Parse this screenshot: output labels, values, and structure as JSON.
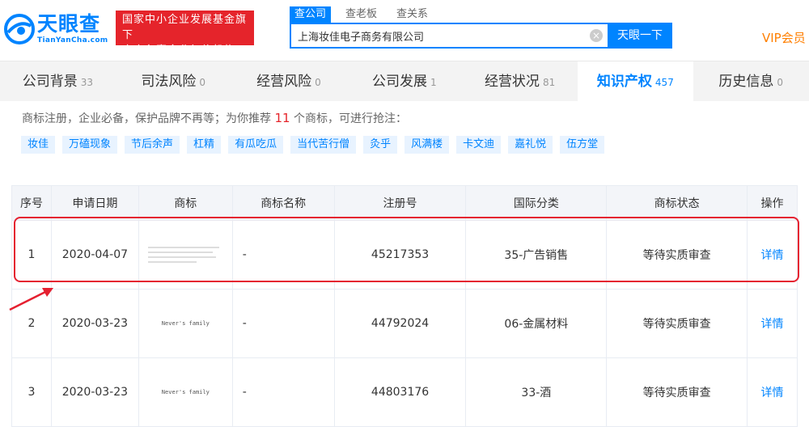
{
  "brand": {
    "name_cn": "天眼查",
    "name_en": "TianYanCha.com",
    "badge_line1": "国家中小企业发展基金旗下",
    "badge_line2": "官方备案企业征信机构"
  },
  "search": {
    "tabs": [
      "查公司",
      "查老板",
      "查关系"
    ],
    "query": "上海妆佳电子商务有限公司",
    "button": "天眼一下"
  },
  "vip": "VIP会员",
  "nav": [
    {
      "label": "公司背景",
      "count": "33"
    },
    {
      "label": "司法风险",
      "count": "0"
    },
    {
      "label": "经营风险",
      "count": "0"
    },
    {
      "label": "公司发展",
      "count": "1"
    },
    {
      "label": "经营状况",
      "count": "81"
    },
    {
      "label": "知识产权",
      "count": "457"
    },
    {
      "label": "历史信息",
      "count": "0"
    }
  ],
  "recommend": {
    "prefix": "商标注册，企业必备，保护品牌不再等；为你推荐",
    "count": "11",
    "suffix": "个商标，可进行抢注：",
    "tags": [
      "妆佳",
      "万磕现象",
      "节后余声",
      "杠精",
      "有瓜吃瓜",
      "当代苦行僧",
      "灸乎",
      "风满楼",
      "卡文迪",
      "嘉礼悦",
      "伍方堂"
    ]
  },
  "table": {
    "headers": [
      "序号",
      "申请日期",
      "商标",
      "商标名称",
      "注册号",
      "国际分类",
      "商标状态",
      "操作"
    ],
    "rows": [
      {
        "no": "1",
        "date": "2020-04-07",
        "mark_text": "",
        "name": "-",
        "reg": "45217353",
        "cls": "35-广告销售",
        "status": "等待实质审查",
        "action": "详情"
      },
      {
        "no": "2",
        "date": "2020-03-23",
        "mark_text": "Never's family",
        "name": "-",
        "reg": "44792024",
        "cls": "06-金属材料",
        "status": "等待实质审查",
        "action": "详情"
      },
      {
        "no": "3",
        "date": "2020-03-23",
        "mark_text": "Never's family",
        "name": "-",
        "reg": "44803176",
        "cls": "33-酒",
        "status": "等待实质审查",
        "action": "详情"
      }
    ]
  },
  "colors": {
    "accent": "#0084ff",
    "brand_red": "#e5242b",
    "vip": "#ff7f00",
    "highlight": "#e52030"
  }
}
